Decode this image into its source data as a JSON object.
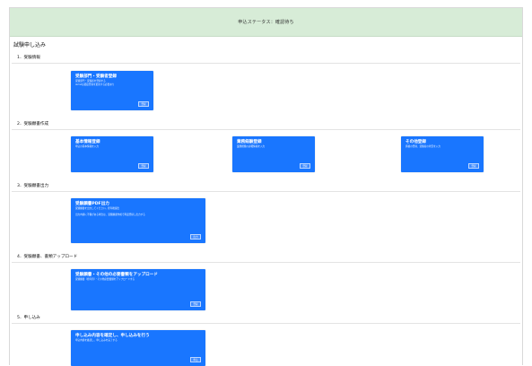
{
  "status_bar": {
    "text": "申込ステータス：確認待ち"
  },
  "page_title": "試験申し込み",
  "sections": [
    {
      "title": "1．受験情報",
      "cards": [
        {
          "title": "受験部門・受験者登録",
          "desc": [
            "受験部門・受験者を登録する",
            "※2ndは都度登録を更新する必要あり"
          ],
          "button": "登録"
        }
      ]
    },
    {
      "title": "2．受験願書作成",
      "cards": [
        {
          "title": "基本情報登録",
          "desc": [
            "申込の基本情報を入力"
          ],
          "button": "登録"
        },
        {
          "title": "業務経験登録",
          "desc": [
            "業務経験の詳細情報を入力"
          ],
          "button": "登録"
        },
        {
          "title": "その他登録",
          "desc": [
            "資格の登録、受験者の状況を入力"
          ],
          "button": "登録"
        }
      ]
    },
    {
      "title": "3．受験願書出力",
      "cards": [
        {
          "title": "受験願書PDF出力",
          "desc": [
            "受験願書を出力してください。捺印後提出",
            "出力内容に不備がある場合は、受験願書作成で再度登録し出力する"
          ],
          "button": "出力"
        }
      ]
    },
    {
      "title": "4．受験願書、書類アップロード",
      "cards": [
        {
          "title": "受験願書・その他の必要書類をアップロード",
          "desc": [
            "受験願書（捺印済）・その他必要書類をアップロードする"
          ],
          "button": "登録"
        }
      ]
    },
    {
      "title": "5．申し込み",
      "cards": [
        {
          "title": "申し込み内容を確定し、申し込みを行う",
          "desc": [
            "申込内容を確認し、申し込みを完了する"
          ],
          "button": "申込"
        }
      ]
    }
  ]
}
